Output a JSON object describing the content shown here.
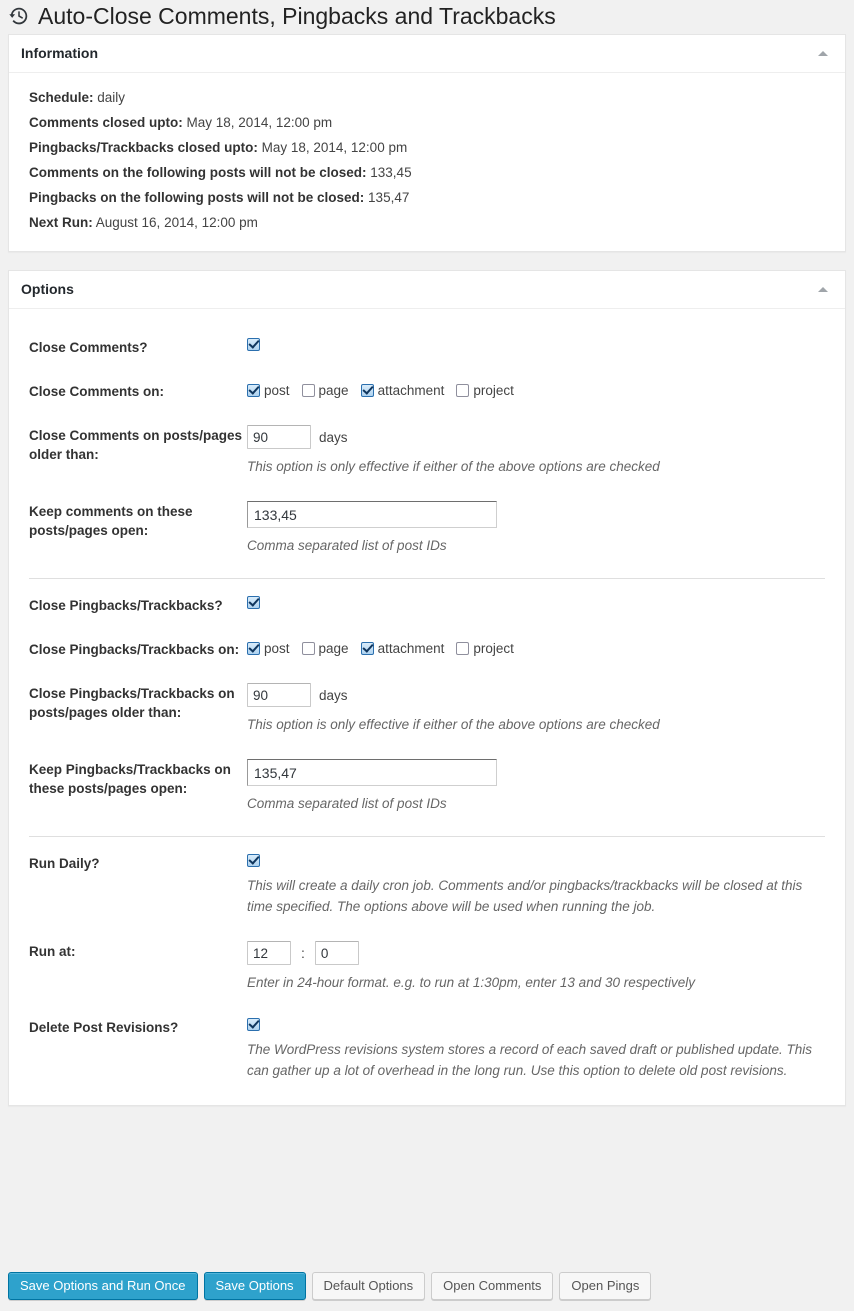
{
  "page": {
    "title": "Auto-Close Comments, Pingbacks and Trackbacks",
    "icon": "backup-clock-icon"
  },
  "information_panel": {
    "title": "Information",
    "toggle_icon": "triangle-up-icon",
    "items": [
      {
        "key": "Schedule:",
        "value": "daily"
      },
      {
        "key": "Comments closed upto:",
        "value": "May 18, 2014, 12:00 pm"
      },
      {
        "key": "Pingbacks/Trackbacks closed upto:",
        "value": "May 18, 2014, 12:00 pm"
      },
      {
        "key": "Comments on the following posts will not be closed:",
        "value": "133,45"
      },
      {
        "key": "Pingbacks on the following posts will not be closed:",
        "value": "135,47"
      },
      {
        "key": "Next Run:",
        "value": "August 16, 2014, 12:00 pm"
      }
    ]
  },
  "options_panel": {
    "title": "Options",
    "toggle_icon": "triangle-up-icon",
    "close_comments": {
      "label": "Close Comments?",
      "checked": true
    },
    "close_comments_on": {
      "label": "Close Comments on:",
      "types": [
        {
          "label": "post",
          "checked": true
        },
        {
          "label": "page",
          "checked": false
        },
        {
          "label": "attachment",
          "checked": true
        },
        {
          "label": "project",
          "checked": false
        }
      ]
    },
    "close_comments_older": {
      "label": "Close Comments on posts/pages older than:",
      "value": "90",
      "unit": "days",
      "description": "This option is only effective if either of the above options are checked"
    },
    "keep_comments_open": {
      "label": "Keep comments on these posts/pages open:",
      "value": "133,45",
      "description": "Comma separated list of post IDs"
    },
    "close_pingbacks": {
      "label": "Close Pingbacks/Trackbacks?",
      "checked": true
    },
    "close_pingbacks_on": {
      "label": "Close Pingbacks/Trackbacks on:",
      "types": [
        {
          "label": "post",
          "checked": true
        },
        {
          "label": "page",
          "checked": false
        },
        {
          "label": "attachment",
          "checked": true
        },
        {
          "label": "project",
          "checked": false
        }
      ]
    },
    "close_pingbacks_older": {
      "label": "Close Pingbacks/Trackbacks on posts/pages older than:",
      "value": "90",
      "unit": "days",
      "description": "This option is only effective if either of the above options are checked"
    },
    "keep_pingbacks_open": {
      "label": "Keep Pingbacks/Trackbacks on these posts/pages open:",
      "value": "135,47",
      "description": "Comma separated list of post IDs"
    },
    "run_daily": {
      "label": "Run Daily?",
      "checked": true,
      "description": "This will create a daily cron job. Comments and/or pingbacks/trackbacks will be closed at this time specified. The options above will be used when running the job."
    },
    "run_at": {
      "label": "Run at:",
      "hour": "12",
      "minute": "0",
      "separator": ":",
      "description": "Enter in 24-hour format. e.g. to run at 1:30pm, enter 13 and 30 respectively"
    },
    "delete_revisions": {
      "label": "Delete Post Revisions?",
      "checked": true,
      "description": "The WordPress revisions system stores a record of each saved draft or published update. This can gather up a lot of overhead in the long run. Use this option to delete old post revisions."
    }
  },
  "footer": {
    "buttons": [
      {
        "label": "Save Options and Run Once",
        "style": "primary"
      },
      {
        "label": "Save Options",
        "style": "primary"
      },
      {
        "label": "Default Options",
        "style": "secondary"
      },
      {
        "label": "Open Comments",
        "style": "secondary"
      },
      {
        "label": "Open Pings",
        "style": "secondary"
      }
    ]
  },
  "colors": {
    "accent": "#2ea2cc",
    "accent_border": "#0074a2",
    "page_bg": "#f1f1f1",
    "panel_bg": "#ffffff",
    "panel_border": "#e5e5e5"
  }
}
